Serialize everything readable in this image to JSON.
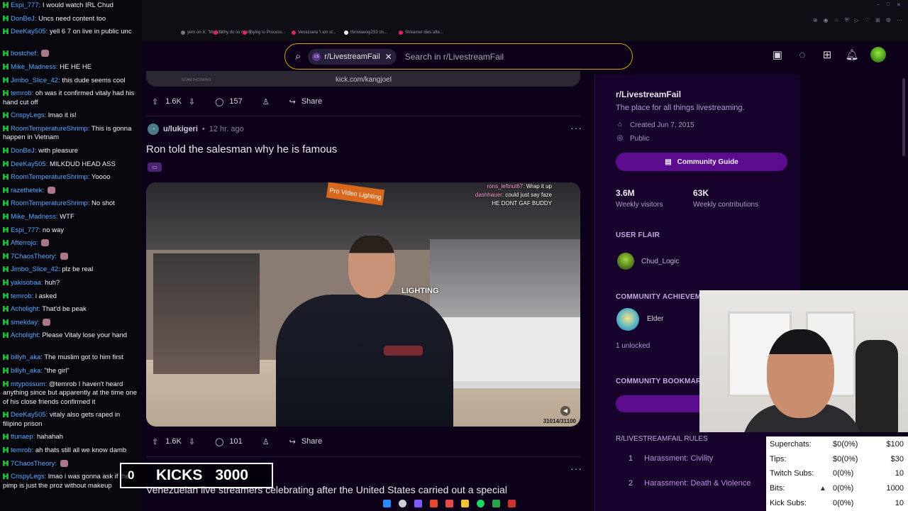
{
  "browser": {
    "tabs": [
      {
        "label": "yem on X: \"Mizkif...",
        "color": "#777777"
      },
      {
        "label": "Why do so many...",
        "color": "#e0245e"
      },
      {
        "label": "Trying to Process...",
        "color": "#e0245e"
      },
      {
        "label": "Venezuela 'I am st...",
        "color": "#e0245e"
      },
      {
        "label": "throwaway233 on...",
        "color": "#eeeeee"
      },
      {
        "label": "Streamer dies afte...",
        "color": "#e0245e"
      }
    ]
  },
  "reddit": {
    "logo": "reddit",
    "search": {
      "subreddit_chip": "r/LivestreamFail",
      "chip_avatar": "LS",
      "placeholder": "Search in r/LivestreamFail"
    }
  },
  "feed": {
    "top_post": {
      "url_overlay": "kick.com/kangjoel",
      "scam_text": "SCAM INCOMING",
      "votes": "1.6K",
      "comments": "157",
      "share": "Share"
    },
    "post": {
      "author": "u/lukigeri",
      "time": "12 hr. ago",
      "title": "Ron told the salesman why he is famous",
      "votes": "1.6K",
      "comments": "101",
      "share": "Share",
      "video": {
        "sign": "Pro Video Lighting",
        "lighting": "LIGHTING",
        "counter": "31014/31100",
        "chat": [
          {
            "n": "rons_leftnut67:",
            "m": "Wrap it up"
          },
          {
            "n": "dashhauer:",
            "m": "could just say faze"
          },
          {
            "n": "",
            "m": "HE DONT GAF BUDDY"
          }
        ]
      }
    },
    "next_post_title": "Venezuelan live streamers celebrating after the United States carried out a special"
  },
  "sidebar": {
    "name": "r/LivestreamFail",
    "description": "The place for all things livestreaming.",
    "created": "Created Jun 7, 2015",
    "visibility": "Public",
    "guide_button": "Community Guide",
    "weekly_visitors": {
      "value": "3.6M",
      "label": "Weekly visitors"
    },
    "weekly_contributions": {
      "value": "63K",
      "label": "Weekly contributions"
    },
    "user_flair_title": "USER FLAIR",
    "flair_name": "Chud_Logic",
    "achievements_title": "COMMUNITY ACHIEVEM",
    "achievement": "Elder",
    "unlocked": "1 unlocked",
    "bookmarks_title": "COMMUNITY BOOKMAR",
    "rules_title": "R/LIVESTREAMFAIL RULES",
    "rules": [
      {
        "num": "1",
        "label": "Harassment: Civility"
      },
      {
        "num": "2",
        "label": "Harassment: Death & Violence"
      }
    ]
  },
  "chat": [
    {
      "user": "Espi_777",
      "text": "I would watch IRL Chud",
      "lines": 1
    },
    {
      "user": "DonBeJ",
      "text": "Uncs need content too",
      "lines": 1
    },
    {
      "user": "DeeKay505",
      "text": "yell 6 7 on live in public unc",
      "lines": 2
    },
    {
      "user": "bostchef",
      "text": "",
      "lines": 1
    },
    {
      "user": "Mike_Madness",
      "text": "HE HE HE",
      "lines": 1
    },
    {
      "user": "Jimbo_Slice_42",
      "text": "this dude seems cool",
      "lines": 1
    },
    {
      "user": "temrob",
      "text": "oh was it confirmed vitaly had his hand cut off",
      "lines": 2
    },
    {
      "user": "CrispyLegs",
      "text": "lmao it is!",
      "lines": 1
    },
    {
      "user": "RoomTemperatureShrimp",
      "text": "This is gonna happen in Vietnam",
      "lines": 2
    },
    {
      "user": "DonBeJ",
      "text": "with pleasure",
      "lines": 1
    },
    {
      "user": "DeeKay505",
      "text": "MILKDUD HEAD ASS",
      "lines": 1
    },
    {
      "user": "RoomTemperatureShrimp",
      "text": "Yoooo",
      "lines": 1
    },
    {
      "user": "razethetek",
      "text": "",
      "lines": 1
    },
    {
      "user": "RoomTemperatureShrimp",
      "text": "No shot",
      "lines": 1
    },
    {
      "user": "Mike_Madness",
      "text": "WTF",
      "lines": 1
    },
    {
      "user": "Espi_777",
      "text": "no way",
      "lines": 1
    },
    {
      "user": "Afterrojo",
      "text": "",
      "lines": 1
    },
    {
      "user": "7ChaosTheory",
      "text": "",
      "lines": 1
    },
    {
      "user": "Jimbo_Slice_42",
      "text": "plz be real",
      "lines": 1
    },
    {
      "user": "yakisobaa",
      "text": "huh?",
      "lines": 1
    },
    {
      "user": "temrob",
      "text": "i asked",
      "lines": 1
    },
    {
      "user": "Acholight",
      "text": "That'd be peak",
      "lines": 1
    },
    {
      "user": "smekday",
      "text": "",
      "lines": 1
    },
    {
      "user": "Acholight",
      "text": "Please Vitaly lose your hand",
      "lines": 2
    },
    {
      "user": "billyh_aka",
      "text": "The muslim got to him first",
      "lines": 1
    },
    {
      "user": "billyh_aka",
      "text": "\"the girl\"",
      "lines": 1
    },
    {
      "user": "mtypossum",
      "text": "@temrob I haven't heard anything since but apparently at the time one of his close friends confirmed it",
      "lines": 3
    },
    {
      "user": "DeeKay505",
      "text": "vitaly also gets raped in filipino prison",
      "lines": 2
    },
    {
      "user": "ttunaep",
      "text": "hahahah",
      "lines": 1
    },
    {
      "user": "temrob",
      "text": "ah thats still all we know damb",
      "lines": 1
    },
    {
      "user": "7ChaosTheory",
      "text": "",
      "lines": 1
    },
    {
      "user": "CrispyLegs",
      "text": "lmao i was gonna ask if the pimp is just the proz without makeup",
      "lines": 2
    }
  ],
  "kicks": {
    "count": "0",
    "label": "KICKS",
    "goal": "3000"
  },
  "support": [
    {
      "label": "Superchats:",
      "value": "$0(0%)",
      "goal": "$100"
    },
    {
      "label": "Tips:",
      "value": "$0(0%)",
      "goal": "$30"
    },
    {
      "label": "Twitch Subs:",
      "value": "0(0%)",
      "goal": "10"
    },
    {
      "label": "Bits:",
      "value": "0(0%)",
      "goal": "1000"
    },
    {
      "label": "Kick Subs:",
      "value": "0(0%)",
      "goal": "10"
    }
  ]
}
